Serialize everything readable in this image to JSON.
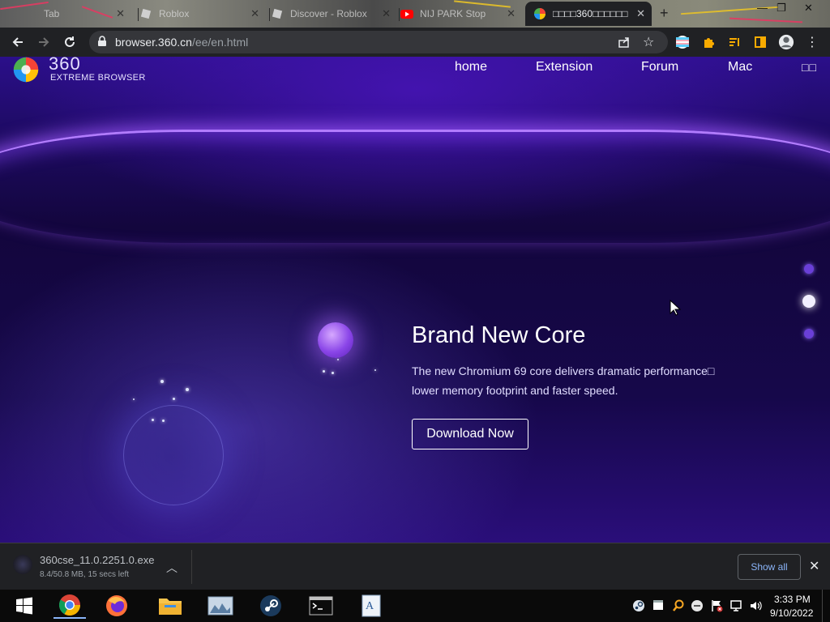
{
  "tabs": [
    {
      "label": "Tab",
      "active": false
    },
    {
      "label": "Roblox",
      "active": false
    },
    {
      "label": "Discover - Roblox",
      "active": false
    },
    {
      "label": "NIJ PARK Stop",
      "active": false
    },
    {
      "label": "□□□□360□□□□□□",
      "active": true
    }
  ],
  "toolbar": {
    "url_host": "browser.360.cn",
    "url_path": "/ee/en.html"
  },
  "site": {
    "logo_number": "360",
    "logo_sub": "EXTREME BROWSER",
    "nav": [
      "home",
      "Extension",
      "Forum",
      "Mac"
    ],
    "nav_extra": "□□"
  },
  "hero": {
    "title": "Brand New Core",
    "line1": "The new Chromium 69 core delivers dramatic performance□",
    "line2": "lower memory footprint and faster speed.",
    "cta": "Download Now",
    "slide_count": 3,
    "active_slide": 2
  },
  "download": {
    "filename": "360cse_11.0.2251.0.exe",
    "status": "8.4/50.8 MB, 15 secs left",
    "show_all": "Show all"
  },
  "taskbar": {
    "time": "3:33 PM",
    "date": "9/10/2022"
  },
  "colors": {
    "accent_purple": "#6a3fd8",
    "link_blue": "#8ab4f8"
  }
}
